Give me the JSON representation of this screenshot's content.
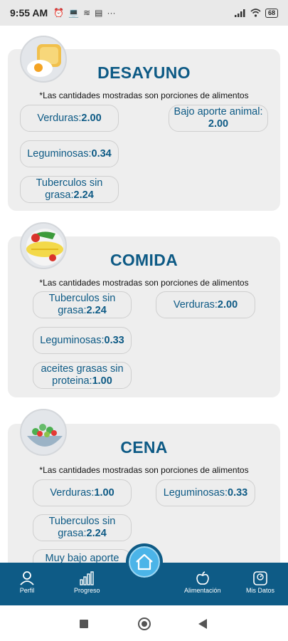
{
  "status": {
    "time": "9:55 AM",
    "battery": "68"
  },
  "note": "*Las cantidades mostradas son porciones de alimentos",
  "desayuno": {
    "title": "DESAYUNO",
    "items": [
      {
        "label": "Verduras:",
        "value": "2.00"
      },
      {
        "label": "Bajo aporte animal:",
        "value": "2.00"
      },
      {
        "label": "Leguminosas:",
        "value": "0.34"
      },
      {
        "label": "Tuberculos sin grasa:",
        "value": "2.24"
      }
    ]
  },
  "comida": {
    "title": "COMIDA",
    "items": [
      {
        "label": "Tuberculos sin grasa:",
        "value": "2.24"
      },
      {
        "label": "Verduras:",
        "value": "2.00"
      },
      {
        "label": "Leguminosas:",
        "value": "0.33"
      },
      {
        "label": "aceites grasas sin proteina:",
        "value": "1.00"
      }
    ]
  },
  "cena": {
    "title": "CENA",
    "items": [
      {
        "label": "Verduras:",
        "value": "1.00"
      },
      {
        "label": "Leguminosas:",
        "value": "0.33"
      },
      {
        "label": "Tuberculos sin grasa:",
        "value": "2.24"
      },
      {
        "label": "Muy bajo aporte",
        "value": ""
      }
    ]
  },
  "nav": {
    "perfil": "Perfil",
    "progreso": "Progreso",
    "alimentacion": "Alimentación",
    "mis_datos": "Mis Datos"
  },
  "colors": {
    "accent": "#0e5b86",
    "title": "#0d5a85",
    "home": "#4bb4e8"
  }
}
